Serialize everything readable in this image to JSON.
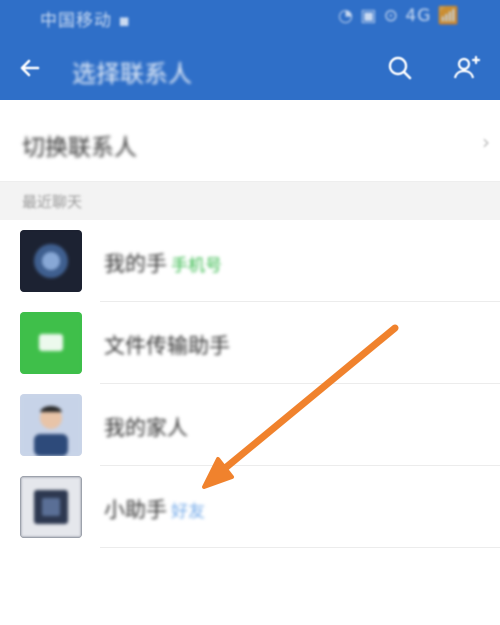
{
  "status_bar": {
    "left_text": "中国移动 ▪︎",
    "right_text": "◔ ▣ ⊙ 4G 📶"
  },
  "toolbar": {
    "title": "选择联系人"
  },
  "section_row": {
    "label": "切换联系人"
  },
  "group_header": {
    "label": "最近聊天"
  },
  "contacts": [
    {
      "name": "我的手",
      "tag": "手机号",
      "tag_color": "#35b94a"
    },
    {
      "name": "文件传输助手",
      "tag": "",
      "tag_color": ""
    },
    {
      "name": "我的家人",
      "tag": "",
      "tag_color": ""
    },
    {
      "name": "小助手",
      "tag": "好友",
      "tag_color": "#6fa7e8"
    }
  ],
  "colors": {
    "app_bar": "#2f6fc8",
    "annotation_arrow": "#f0822d",
    "wechat_green": "#3fbf4a"
  }
}
